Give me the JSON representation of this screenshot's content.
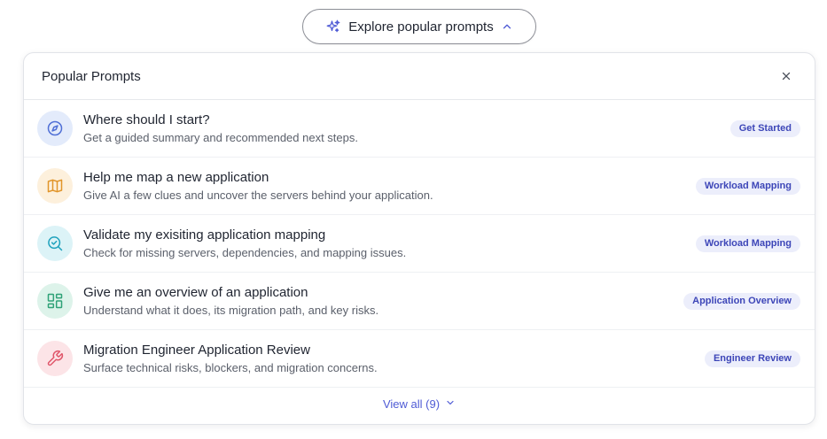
{
  "explore_button": {
    "label": "Explore popular prompts",
    "icon": "sparkles-icon",
    "chevron": "chevron-up-icon"
  },
  "panel": {
    "title": "Popular Prompts",
    "close_icon": "close-icon",
    "prompts": [
      {
        "title": "Where should I start?",
        "description": "Get a guided summary and recommended next steps.",
        "badge": "Get Started",
        "icon": "compass-icon",
        "icon_bg": "#e3ebfb",
        "icon_color": "#4f6fd6"
      },
      {
        "title": "Help me map a new application",
        "description": "Give AI a few clues and uncover the servers behind your application.",
        "badge": "Workload Mapping",
        "icon": "map-icon",
        "icon_bg": "#fdf0dc",
        "icon_color": "#e1952a"
      },
      {
        "title": "Validate my exisiting application mapping",
        "description": "Check for missing servers, dependencies, and mapping issues.",
        "badge": "Workload Mapping",
        "icon": "search-check-icon",
        "icon_bg": "#dcf3f7",
        "icon_color": "#1fa2bd"
      },
      {
        "title": "Give me an overview of an application",
        "description": "Understand what it does, its migration path, and key risks.",
        "badge": "Application Overview",
        "icon": "layout-grid-icon",
        "icon_bg": "#ddf3ea",
        "icon_color": "#2fa277"
      },
      {
        "title": "Migration Engineer Application Review",
        "description": "Surface technical risks, blockers, and migration concerns.",
        "badge": "Engineer Review",
        "icon": "wrench-icon",
        "icon_bg": "#fce4e7",
        "icon_color": "#e0566a"
      }
    ],
    "view_all_label": "View all (9)",
    "view_all_icon": "chevron-down-icon"
  },
  "colors": {
    "badge_bg": "#eceefb",
    "badge_text": "#3d46b8",
    "link": "#4f5bd5"
  }
}
